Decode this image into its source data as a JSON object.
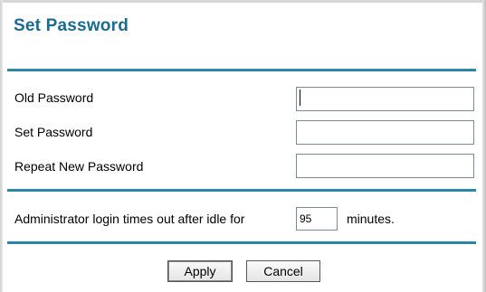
{
  "page": {
    "title": "Set Password"
  },
  "form": {
    "old_password_label": "Old Password",
    "old_password_value": "",
    "set_password_label": "Set Password",
    "set_password_value": "",
    "repeat_password_label": "Repeat New Password",
    "repeat_password_value": "",
    "timeout_text": "Administrator login times out after idle for",
    "timeout_value": "95",
    "timeout_unit": "minutes."
  },
  "buttons": {
    "apply_label": "Apply",
    "cancel_label": "Cancel"
  },
  "colors": {
    "title": "#1a6b8f",
    "rule": "#2a87a8"
  }
}
